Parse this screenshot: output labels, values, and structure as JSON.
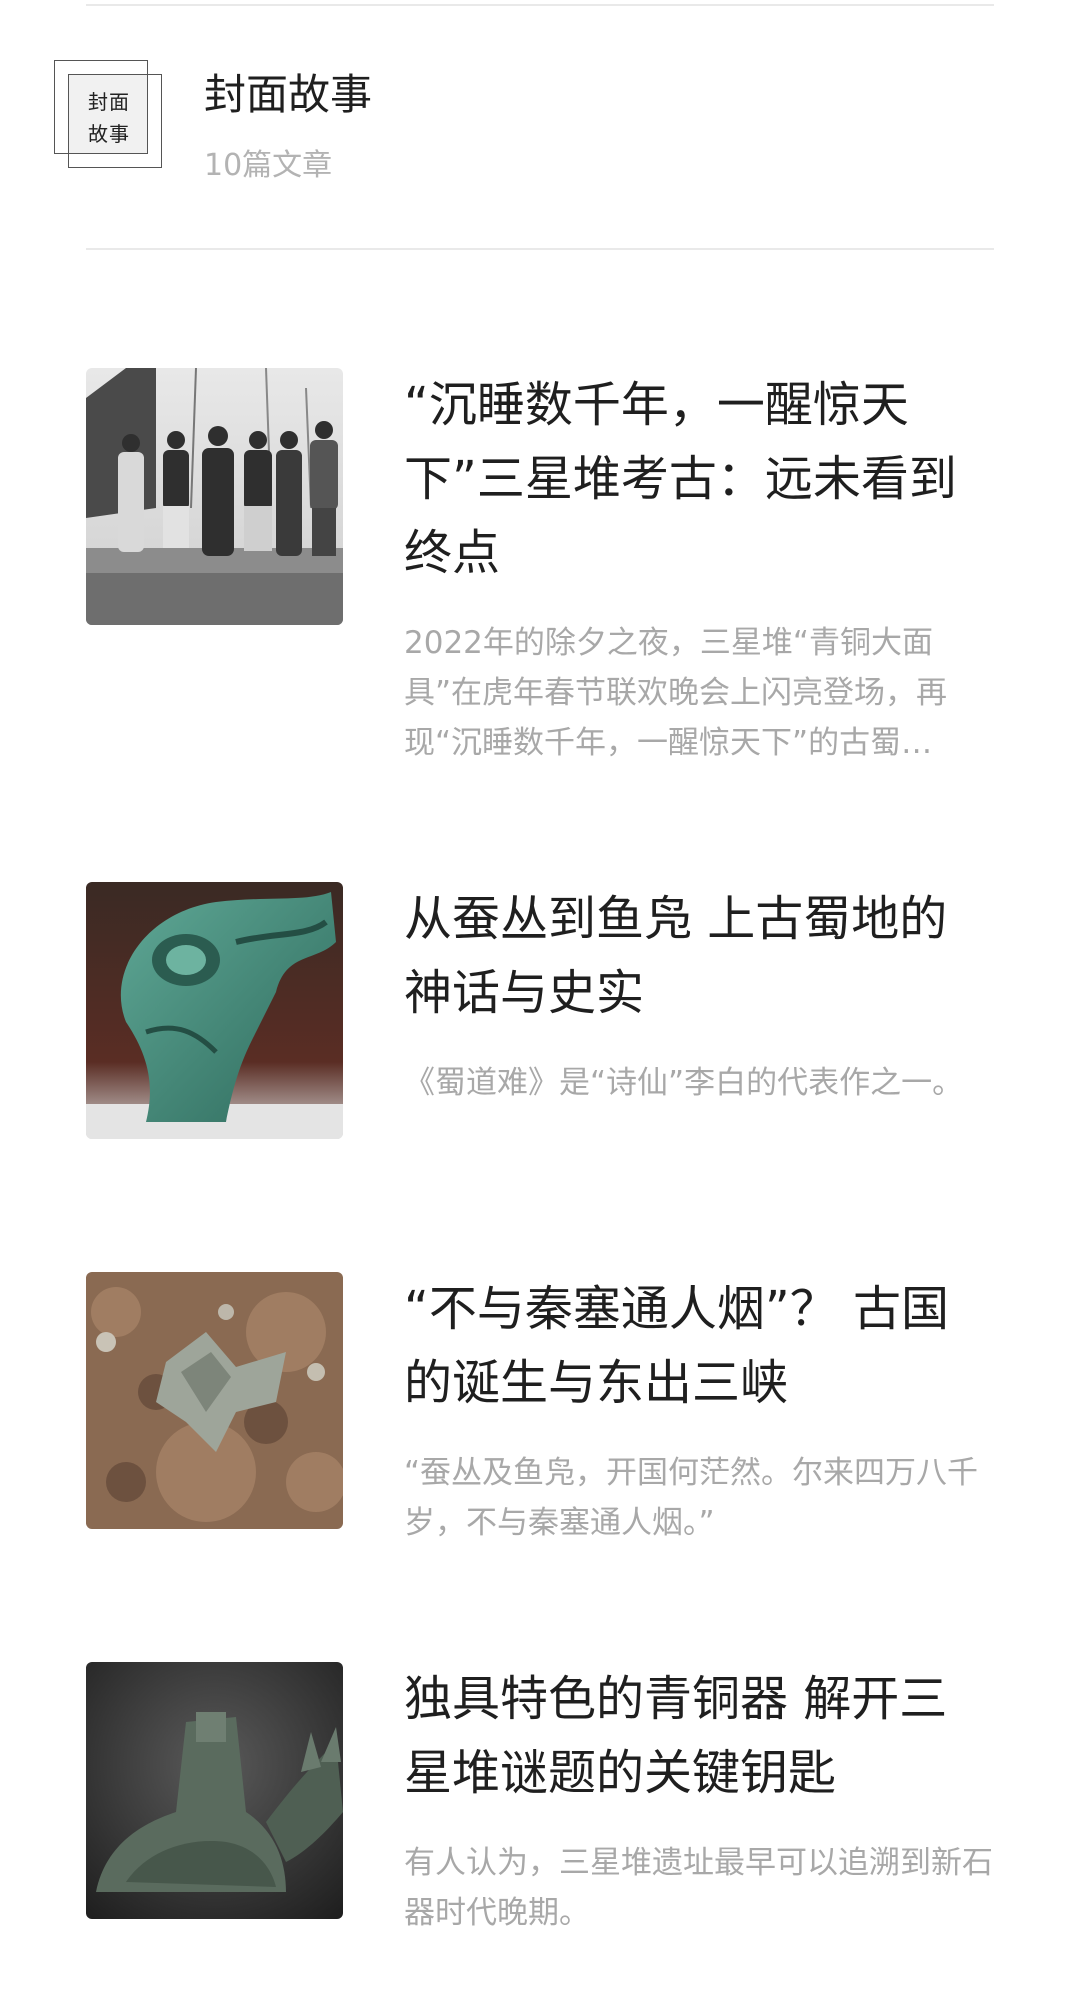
{
  "header": {
    "logo_text_line1": "封面",
    "logo_text_line2": "故事",
    "title": "封面故事",
    "count": "10篇文章"
  },
  "articles": [
    {
      "title": "“沉睡数千年，一醒惊天下”三星堆考古：远未看到终点",
      "summary": "2022年的除夕之夜，三星堆“青铜大面具”在虎年春节联欢晚会上闪亮登场，再现“沉睡数千年，一醒惊天下”的古蜀…",
      "thumbnail": "historic-group-photo"
    },
    {
      "title": "从蚕丛到鱼凫 上古蜀地的神话与史实",
      "summary": "《蜀道难》是“诗仙”李白的代表作之一。",
      "thumbnail": "bronze-bird-head"
    },
    {
      "title": "“不与秦塞通人烟”？ 古国的诞生与东出三峡",
      "summary": "“蚕丛及鱼凫，开国何茫然。尔来四万八千岁，不与秦塞通人烟。”",
      "thumbnail": "excavated-artifacts"
    },
    {
      "title": "独具特色的青铜器 解开三星堆谜题的关键钥匙",
      "summary": "有人认为，三星堆遗址最早可以追溯到新石器时代晚期。",
      "thumbnail": "bronze-sacred-beast"
    }
  ]
}
